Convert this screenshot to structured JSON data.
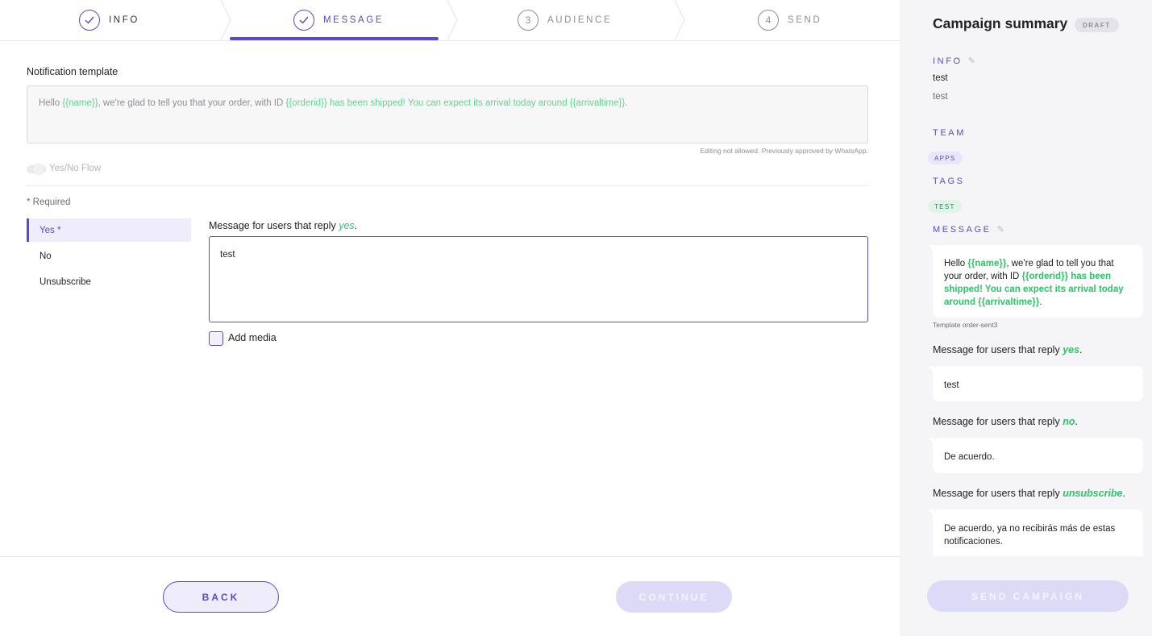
{
  "stepper": {
    "steps": [
      {
        "label": "INFO",
        "number": "",
        "status": "done"
      },
      {
        "label": "MESSAGE",
        "number": "",
        "status": "active"
      },
      {
        "label": "AUDIENCE",
        "number": "3",
        "status": "pending"
      },
      {
        "label": "SEND",
        "number": "4",
        "status": "pending"
      }
    ]
  },
  "template": {
    "label": "Notification template",
    "segments": [
      {
        "text": "Hello ",
        "var": false
      },
      {
        "text": "{{name}}",
        "var": true
      },
      {
        "text": ", we're glad to tell you that your order, with ID ",
        "var": false
      },
      {
        "text": "{{orderid}} has been shipped! You can expect its arrival today around {{arrivaltime}}",
        "var": true
      },
      {
        "text": ".",
        "var": false
      }
    ],
    "note": "Editing not allowed. Previously approved by WhatsApp."
  },
  "flow_toggle": {
    "label": "Yes/No Flow",
    "enabled": false
  },
  "required_note": "* Required",
  "replies": {
    "items": [
      "Yes *",
      "No",
      "Unsubscribe"
    ],
    "active_index": 0
  },
  "message_editor": {
    "label_prefix": "Message for users that reply ",
    "reply_word": "yes",
    "label_suffix": ".",
    "value": "test",
    "add_media_label": "Add media",
    "add_media_checked": false
  },
  "footer": {
    "back_label": "BACK",
    "continue_label": "CONTINUE",
    "send_label": "SEND CAMPAIGN"
  },
  "summary": {
    "title": "Campaign summary",
    "badge": "DRAFT",
    "info_title": "INFO",
    "info_name": "test",
    "info_description": "test",
    "team_title": "TEAM",
    "team_chip": "APPS",
    "tags_title": "TAGS",
    "tag_chip": "TEST",
    "message_title": "MESSAGE",
    "template_bubble": [
      {
        "text": "Hello ",
        "var": false
      },
      {
        "text": "{{name}}",
        "var": true
      },
      {
        "text": ", we're glad to tell you that your order, with ID ",
        "var": false
      },
      {
        "text": "{{orderid}} has been shipped! You can expect its arrival today around {{arrivaltime}}",
        "var": true
      },
      {
        "text": ".",
        "var": false
      }
    ],
    "template_name": "Template order-sent3",
    "reply_prefix": "Message for users that reply ",
    "replies": [
      {
        "word": "yes",
        "message": "test"
      },
      {
        "word": "no",
        "message": "De acuerdo."
      },
      {
        "word": "unsubscribe",
        "message": "De acuerdo, ya no recibirás más de estas notificaciones."
      }
    ]
  },
  "colors": {
    "accent": "#5b4bc4",
    "variable_green": "#2fc36a",
    "disabled_button": "#dcdaf7"
  }
}
